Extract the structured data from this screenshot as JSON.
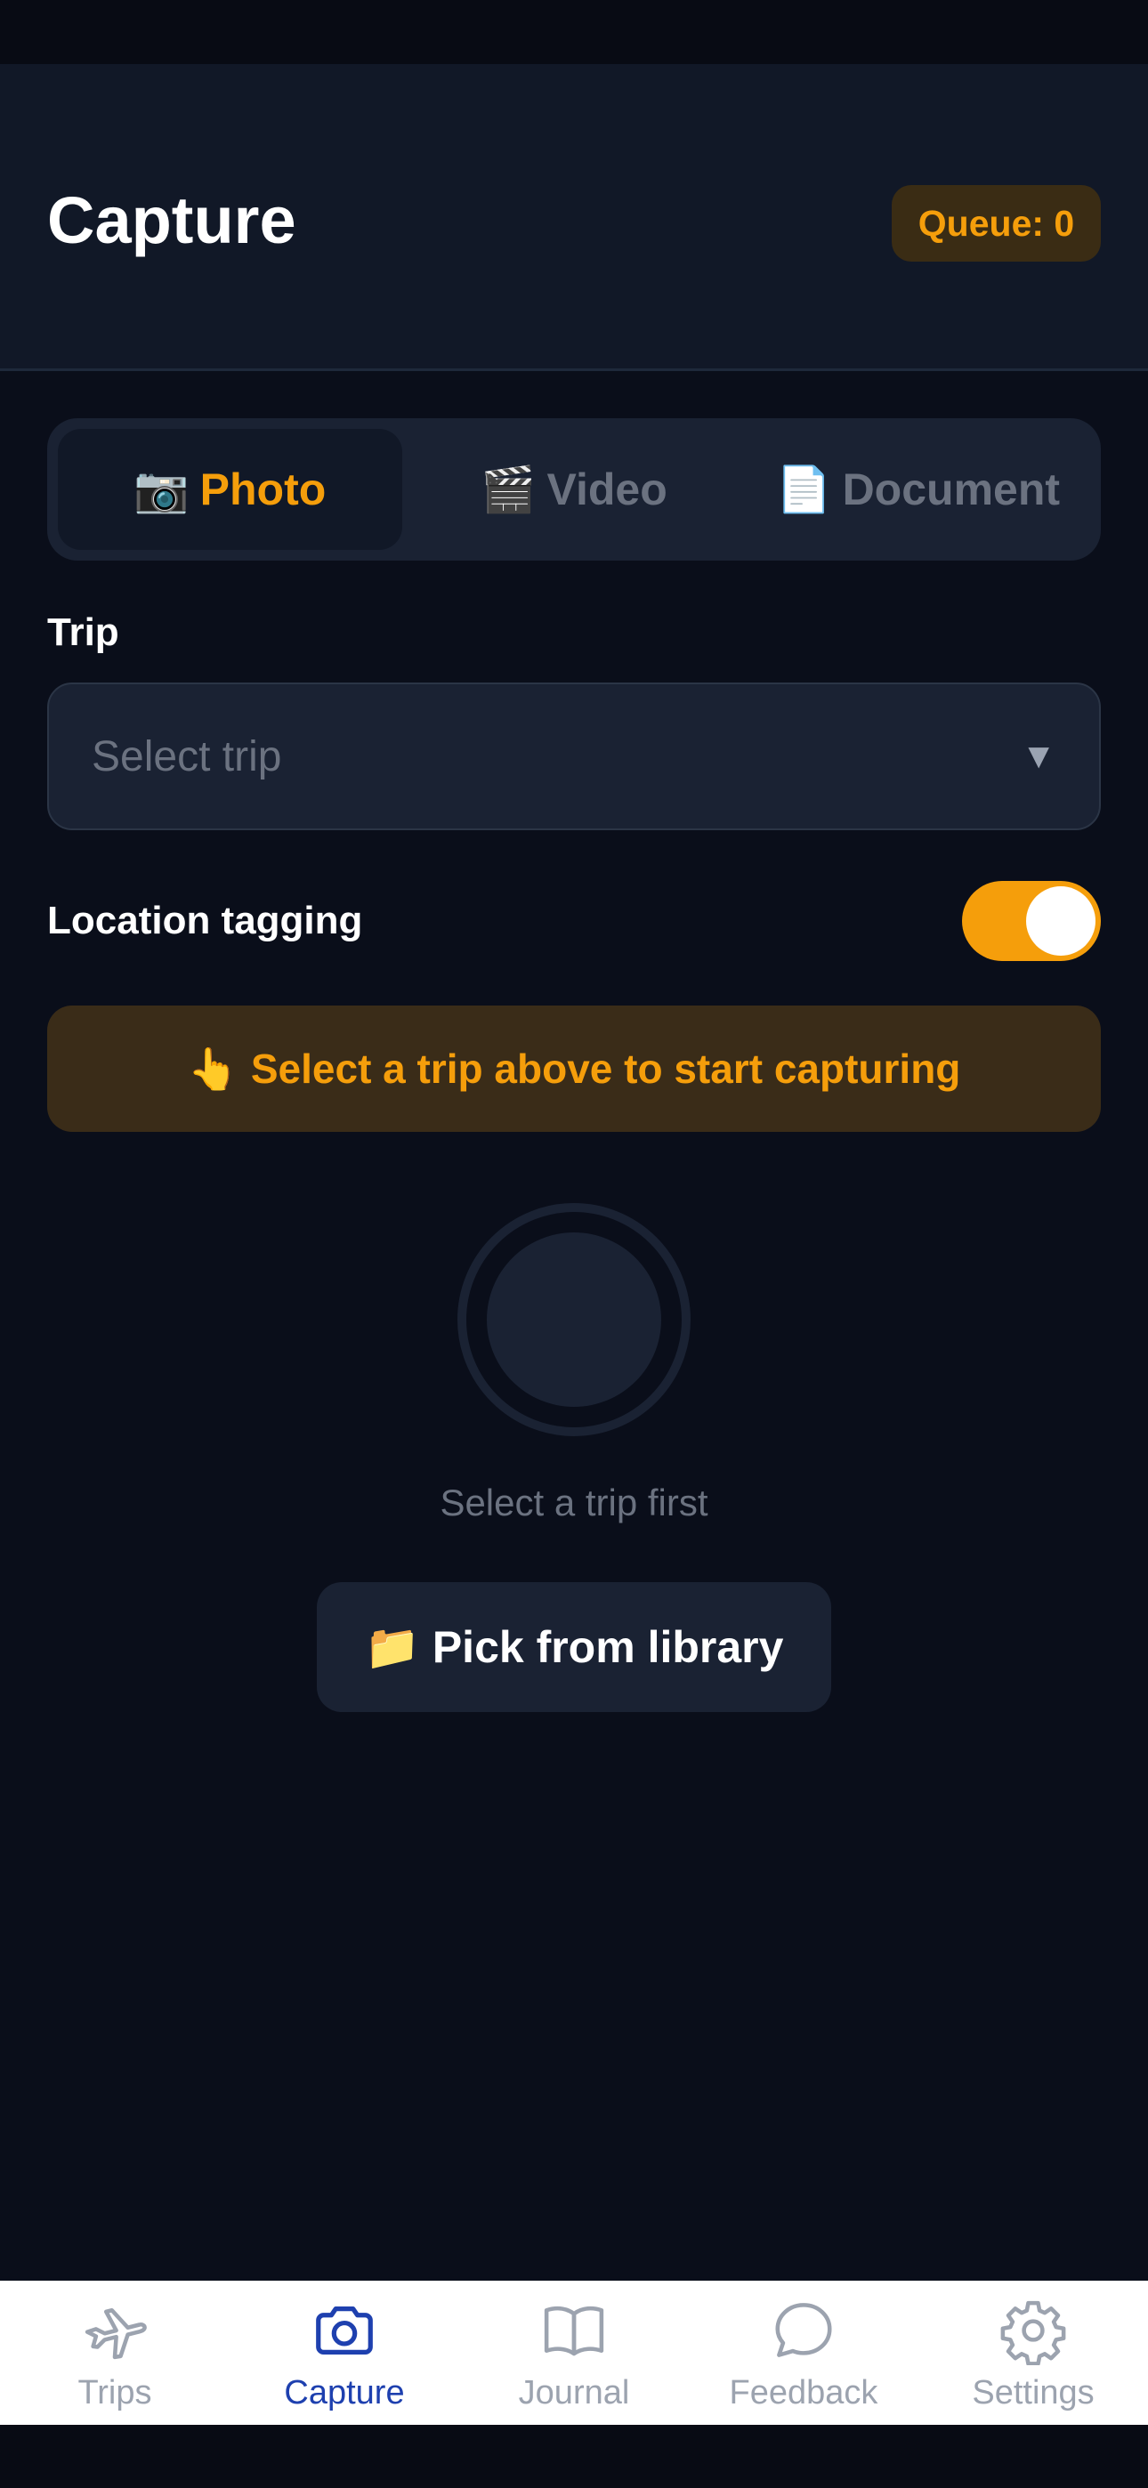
{
  "header": {
    "title": "Capture",
    "queue_badge": "Queue: 0"
  },
  "capture_mode": {
    "options": [
      {
        "icon": "camera-icon",
        "glyph": "📷",
        "label": "Photo",
        "active": true
      },
      {
        "icon": "clapperboard-icon",
        "glyph": "🎬",
        "label": "Video",
        "active": false
      },
      {
        "icon": "document-icon",
        "glyph": "📄",
        "label": "Document",
        "active": false
      }
    ]
  },
  "trip": {
    "label": "Trip",
    "placeholder": "Select trip",
    "chevron": "▼"
  },
  "location": {
    "label": "Location tagging",
    "enabled": true
  },
  "banner": {
    "icon": "pointing-hand-icon",
    "glyph": "👆",
    "text": "Select a trip above to start capturing"
  },
  "shutter": {
    "hint": "Select a trip first"
  },
  "library": {
    "icon": "folder-icon",
    "glyph": "📁",
    "label": "Pick from library"
  },
  "tabbar": {
    "items": [
      {
        "icon": "airplane-icon",
        "label": "Trips",
        "active": false
      },
      {
        "icon": "camera-icon",
        "label": "Capture",
        "active": true
      },
      {
        "icon": "book-icon",
        "label": "Journal",
        "active": false
      },
      {
        "icon": "chat-bubble-icon",
        "label": "Feedback",
        "active": false
      },
      {
        "icon": "gear-icon",
        "label": "Settings",
        "active": false
      }
    ]
  },
  "colors": {
    "accent": "#f59e0b",
    "active_tab": "#1e40af",
    "background": "#0a0e1a"
  }
}
